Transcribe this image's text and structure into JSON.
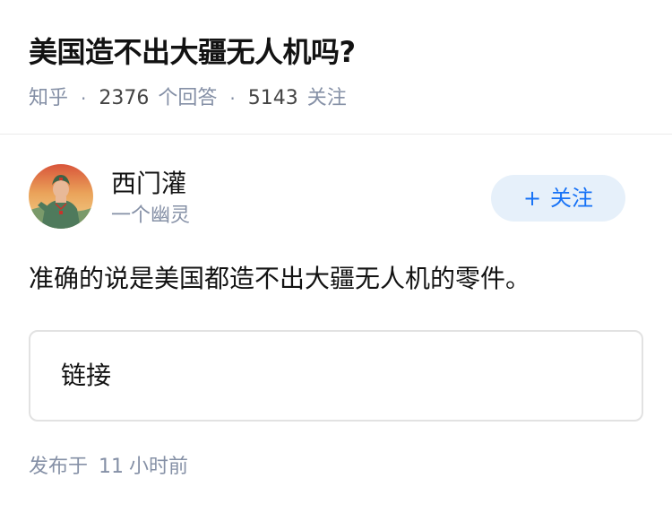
{
  "question": {
    "title": "美国造不出大疆无人机吗?",
    "source": "知乎",
    "answer_count": "2376",
    "answer_count_label": "个回答",
    "follower_count": "5143",
    "follower_count_label": "关注",
    "separator": "·"
  },
  "author": {
    "name": "西门灌",
    "bio": "一个幽灵",
    "follow_plus": "+",
    "follow_label": "关注"
  },
  "answer": {
    "text": "准确的说是美国都造不出大疆无人机的零件。",
    "link_card_label": "链接",
    "published_prefix": "发布于",
    "published_num": "11",
    "published_suffix": "小时前"
  },
  "colors": {
    "accent": "#1772f6",
    "follow_bg": "#e6f0fa",
    "meta_gray": "#8590a6"
  },
  "icons": {
    "avatar": "propaganda-poster-avatar"
  }
}
